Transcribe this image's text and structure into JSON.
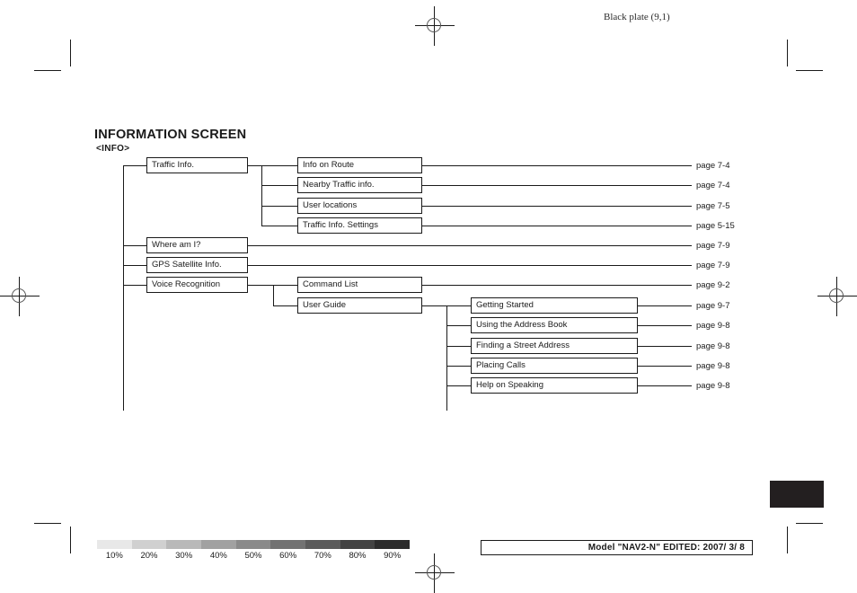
{
  "header": {
    "black_plate": "Black plate (9,1)"
  },
  "title": {
    "main": "INFORMATION SCREEN",
    "sub": "<INFO>"
  },
  "tree": {
    "level1": [
      {
        "label": "Traffic Info."
      },
      {
        "label": "Where am I?",
        "page": "page 7-9"
      },
      {
        "label": "GPS Satellite Info.",
        "page": "page 7-9"
      },
      {
        "label": "Voice Recognition"
      }
    ],
    "level2_traffic": [
      {
        "label": "Info on Route",
        "page": "page 7-4"
      },
      {
        "label": "Nearby Traffic info.",
        "page": "page 7-4"
      },
      {
        "label": "User locations",
        "page": "page 7-5"
      },
      {
        "label": "Traffic Info. Settings",
        "page": "page 5-15"
      }
    ],
    "level2_voice": [
      {
        "label": "Command List",
        "page": "page 9-2"
      },
      {
        "label": "User Guide"
      }
    ],
    "level3_userguide": [
      {
        "label": "Getting Started",
        "page": "page 9-7"
      },
      {
        "label": "Using the Address Book",
        "page": "page 9-8"
      },
      {
        "label": "Finding a Street Address",
        "page": "page 9-8"
      },
      {
        "label": "Placing Calls",
        "page": "page 9-8"
      },
      {
        "label": "Help on Speaking",
        "page": "page 9-8"
      }
    ]
  },
  "density_scale": {
    "labels": [
      "10%",
      "20%",
      "30%",
      "40%",
      "50%",
      "60%",
      "70%",
      "80%",
      "90%"
    ]
  },
  "footer": {
    "model_text": "Model \"NAV2-N\"  EDITED:  2007/ 3/ 8"
  }
}
